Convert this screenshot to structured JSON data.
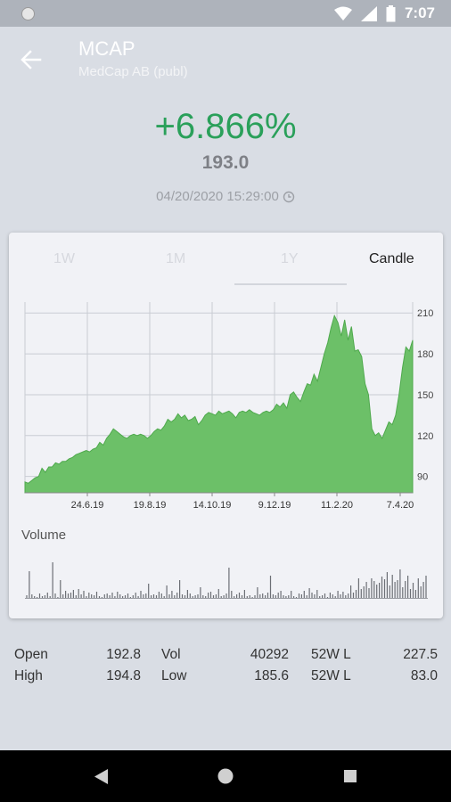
{
  "status_bar": {
    "time": "7:07"
  },
  "header": {
    "ticker": "MCAP",
    "company": "MedCap AB (publ)"
  },
  "quote": {
    "change": "+6.866%",
    "price": "193.0",
    "timestamp": "04/20/2020 15:29:00"
  },
  "tabs": [
    {
      "label": "1W"
    },
    {
      "label": "1M"
    },
    {
      "label": "1Y",
      "selected": true
    },
    {
      "label": "Candle"
    }
  ],
  "chart_data": {
    "type": "area",
    "series": [
      {
        "values": [
          86,
          85,
          87,
          89,
          90,
          96,
          93,
          97,
          97,
          100,
          99,
          101,
          101,
          103,
          104,
          106,
          107,
          108,
          109,
          108,
          110,
          111,
          115,
          113,
          118,
          121,
          125,
          123,
          121,
          119,
          118,
          120,
          121,
          120,
          121,
          120,
          118,
          120,
          123,
          125,
          124,
          127,
          132,
          130,
          132,
          136,
          133,
          135,
          131,
          132,
          134,
          128,
          131,
          135,
          137,
          136,
          135,
          138,
          136,
          137,
          138,
          136,
          133,
          137,
          138,
          137,
          139,
          137,
          136,
          135,
          137,
          138,
          137,
          139,
          143,
          141,
          144,
          140,
          150,
          152,
          148,
          145,
          152,
          158,
          157,
          165,
          160,
          170,
          180,
          188,
          199,
          208,
          203,
          193,
          205,
          190,
          200,
          182,
          183,
          178,
          158,
          150,
          125,
          120,
          122,
          118,
          124,
          130,
          128,
          135,
          150,
          170,
          185,
          182,
          190
        ]
      }
    ],
    "x_tick_labels": [
      "24.6.19",
      "19.8.19",
      "14.10.19",
      "9.12.19",
      "11.2.20",
      "7.4.20"
    ],
    "y_tick_labels": [
      "210",
      "180",
      "150",
      "120",
      "90"
    ],
    "ylim": [
      78,
      218
    ],
    "grid": true,
    "color": "#6cc068",
    "volume": {
      "label": "Volume",
      "values": [
        3,
        30,
        4,
        2,
        1,
        5,
        2,
        3,
        6,
        2,
        40,
        5,
        1,
        20,
        4,
        8,
        5,
        6,
        9,
        3,
        10,
        4,
        8,
        2,
        6,
        4,
        3,
        7,
        2,
        1,
        4,
        5,
        3,
        6,
        2,
        7,
        4,
        2,
        3,
        5,
        1,
        3,
        6,
        2,
        8,
        4,
        5,
        16,
        3,
        4,
        3,
        7,
        5,
        2,
        14,
        4,
        8,
        3,
        6,
        20,
        4,
        3,
        9,
        5,
        2,
        3,
        4,
        12,
        3,
        2,
        6,
        7,
        3,
        4,
        10,
        2,
        3,
        5,
        34,
        8,
        2,
        4,
        6,
        3,
        9,
        2,
        3,
        1,
        3,
        12,
        4,
        5,
        3,
        6,
        25,
        4,
        3,
        6,
        8,
        3,
        2,
        3,
        8,
        2,
        1,
        5,
        4,
        8,
        3,
        11,
        6,
        4,
        9,
        2,
        3,
        5,
        1,
        6,
        4,
        2,
        8,
        4,
        7,
        3,
        5,
        14,
        6,
        9,
        22,
        10,
        13,
        18,
        11,
        22,
        19,
        15,
        17,
        24,
        21,
        29,
        14,
        26,
        18,
        20,
        32,
        12,
        19,
        25,
        10,
        17,
        9,
        22,
        13,
        18,
        25
      ]
    }
  },
  "stats": {
    "open": {
      "label": "Open",
      "value": "192.8"
    },
    "high": {
      "label": "High",
      "value": "194.8"
    },
    "vol": {
      "label": "Vol",
      "value": "40292"
    },
    "low": {
      "label": "Low",
      "value": "185.6"
    },
    "w52_a": {
      "label": "52W L",
      "value": "227.5"
    },
    "w52_b": {
      "label": "52W L",
      "value": "83.0"
    }
  },
  "colors": {
    "accent": "#2aa05a",
    "chart_fill": "#6cc068",
    "chart_line": "#4fa94d",
    "background": "#d9dde4"
  }
}
